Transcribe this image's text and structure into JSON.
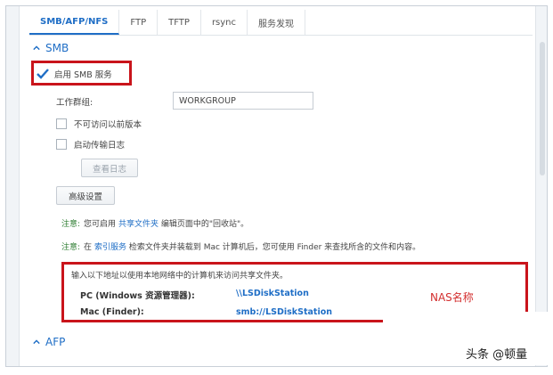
{
  "tabs": [
    "SMB/AFP/NFS",
    "FTP",
    "TFTP",
    "rsync",
    "服务发现"
  ],
  "smb": {
    "section_title": "SMB",
    "enable_label": "启用 SMB 服务",
    "workgroup_label": "工作群组:",
    "workgroup_value": "WORKGROUP",
    "hide_previous_versions_label": "不可访问以前版本",
    "transfer_log_label": "启动传输日志",
    "view_log_button": "查看日志",
    "advanced_button": "高级设置"
  },
  "notes": {
    "note1_label": "注意:",
    "note1_pre": "您可启用",
    "note1_link": "共享文件夹",
    "note1_post": "编辑页面中的\"回收站\"。",
    "note2_label": "注意:",
    "note2_pre": "在",
    "note2_link": "索引服务",
    "note2_post": "检索文件夹并装载到 Mac 计算机后，您可使用 Finder 来查找所含的文件和内容。"
  },
  "address": {
    "intro": "输入以下地址以使用本地网络中的计算机来访问共享文件夹。",
    "pc_label": "PC (Windows 资源管理器):",
    "pc_value": "\\\\LSDiskStation",
    "mac_label": "Mac (Finder):",
    "mac_value": "smb://LSDiskStation",
    "annotation": "NAS名称"
  },
  "afp": {
    "section_title": "AFP"
  },
  "watermark": "头条 @顿量",
  "colors": {
    "accent": "#1f6ec6",
    "highlight_red": "#c9141b",
    "note_green": "#2e7d32"
  }
}
